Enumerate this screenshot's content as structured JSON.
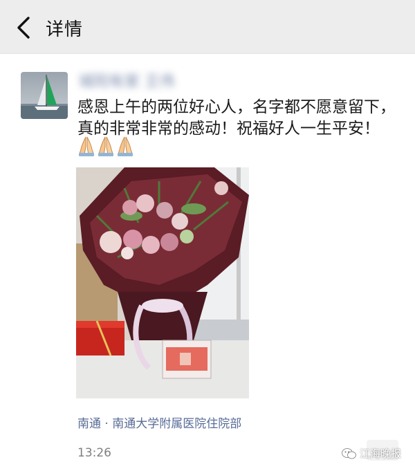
{
  "header": {
    "title": "详情",
    "back_icon": "chevron-left-icon"
  },
  "post": {
    "author_name": "城阳有家 王伟",
    "text_line1": "感恩上午的两位好心人，名字都不愿意留下，",
    "text_line2": "真的非常非常的感动！祝福好人一生平安！",
    "emoji_icon": "praying-hands-icon",
    "emoji_count": 3,
    "location": "南通 · 南通大学附属医院住院部",
    "time": "13:26"
  },
  "watermark": {
    "text": "江海晚报"
  },
  "colors": {
    "header_bg": "#ededed",
    "link_blue": "#576b95",
    "time_gray": "#7f7f7f"
  }
}
